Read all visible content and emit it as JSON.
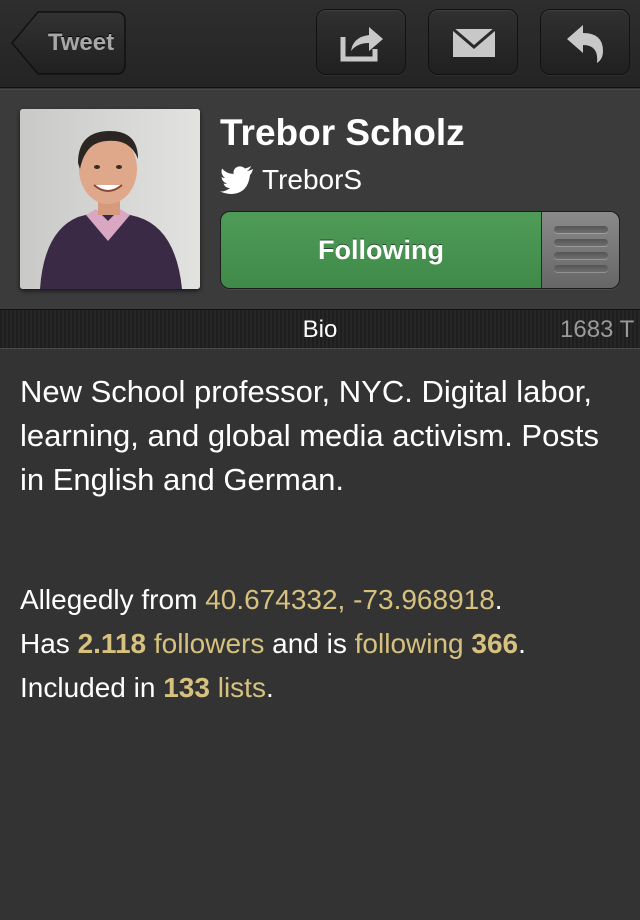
{
  "toolbar": {
    "back_label": "Tweet",
    "share_icon": "share-icon",
    "mail_icon": "mail-icon",
    "reply_icon": "reply-icon"
  },
  "profile": {
    "name": "Trebor Scholz",
    "handle": "TreborS",
    "follow_label": "Following",
    "follow_color": "#4a9653"
  },
  "tabs": {
    "bio": "Bio",
    "tweets_partial": "1683 T"
  },
  "bio": {
    "text": "New School professor, NYC. Digital labor, learning, and global media activism. Posts in English and German.",
    "location_prefix": "Allegedly from ",
    "location": "40.674332, -73.968918",
    "location_suffix": ".",
    "has_prefix": "Has ",
    "followers_count": "2.118",
    "followers_label": " followers",
    "following_middle": " and is ",
    "following_label": "following",
    "following_count": " 366",
    "following_suffix": ".",
    "lists_prefix": "Included in ",
    "lists_count": "133",
    "lists_label": " lists",
    "lists_suffix": "."
  },
  "colors": {
    "link": "#d6c27e",
    "background": "#333333"
  }
}
